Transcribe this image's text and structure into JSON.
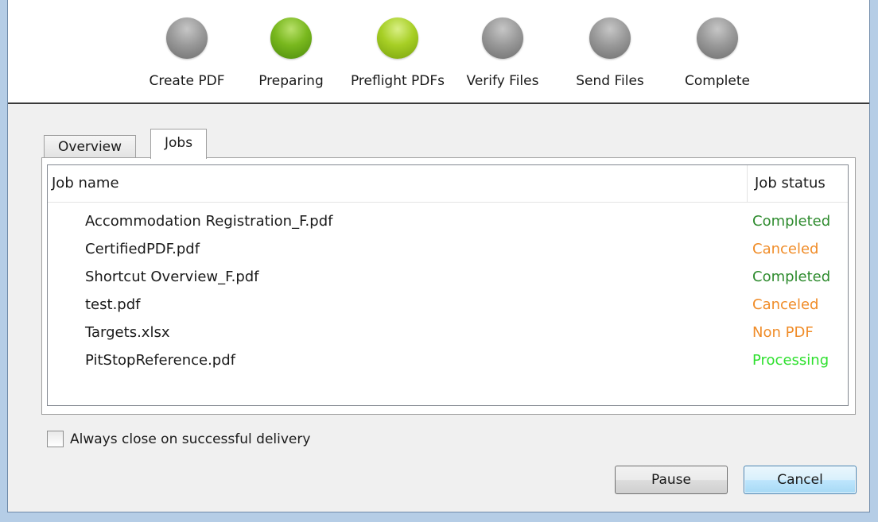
{
  "steps": [
    {
      "label": "Create PDF",
      "state": "grey"
    },
    {
      "label": "Preparing",
      "state": "green"
    },
    {
      "label": "Preflight PDFs",
      "state": "lime"
    },
    {
      "label": "Verify Files",
      "state": "grey"
    },
    {
      "label": "Send Files",
      "state": "grey"
    },
    {
      "label": "Complete",
      "state": "grey"
    }
  ],
  "tabs": [
    {
      "label": "Overview",
      "active": false
    },
    {
      "label": "Jobs",
      "active": true
    }
  ],
  "jobs_table": {
    "headers": {
      "name": "Job name",
      "status": "Job status"
    },
    "rows": [
      {
        "name": "Accommodation Registration_F.pdf",
        "status": "Completed",
        "status_color": "#2e8b2e"
      },
      {
        "name": "CertifiedPDF.pdf",
        "status": "Canceled",
        "status_color": "#f08c28"
      },
      {
        "name": "Shortcut Overview_F.pdf",
        "status": "Completed",
        "status_color": "#2e8b2e"
      },
      {
        "name": "test.pdf",
        "status": "Canceled",
        "status_color": "#f08c28"
      },
      {
        "name": "Targets.xlsx",
        "status": "Non PDF",
        "status_color": "#f08c28"
      },
      {
        "name": "PitStopReference.pdf",
        "status": "Processing",
        "status_color": "#2ee02e"
      }
    ]
  },
  "options": {
    "always_close_label": "Always close on successful delivery",
    "always_close_checked": false
  },
  "buttons": {
    "pause": "Pause",
    "cancel": "Cancel"
  },
  "colors": {
    "step_grey": "#8f8f8f",
    "step_green": "#79b81e",
    "step_lime": "#a7cf25",
    "window_frame": "#b5cde6"
  }
}
